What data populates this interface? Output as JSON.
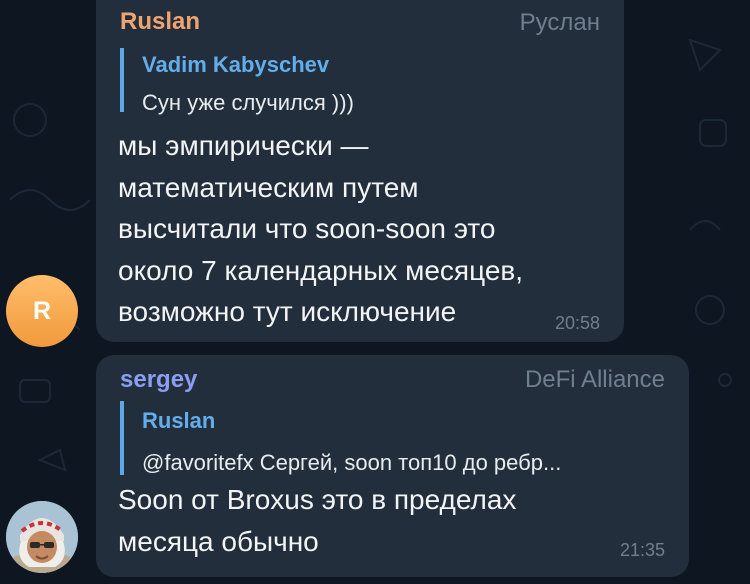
{
  "theme": {
    "background": "#0e1621",
    "bubble": "#222e3b",
    "reply_accent": "#5da6e8",
    "ruslan_name_color": "#f0a470",
    "sergey_name_color": "#8c9ef2"
  },
  "messages": [
    {
      "sender": "Ruslan",
      "title": "Руслан",
      "avatar_letter": "R",
      "reply": {
        "author": "Vadim Kabyschev",
        "text": "Сун уже случился )))"
      },
      "lines": [
        "мы эмпирически  —",
        "математическим путем",
        "высчитали что soon-soon это",
        "около 7 календарных месяцев,",
        "возможно тут исключение"
      ],
      "time": "20:58"
    },
    {
      "sender": "sergey",
      "title": "DeFi Alliance",
      "avatar_icon": "user-photo",
      "reply": {
        "author": "Ruslan",
        "text": "@favoritefx Сергей,  soon топ10 до ребр..."
      },
      "lines": [
        "Soon от Broxus это в пределах",
        "месяца обычно"
      ],
      "time": "21:35"
    }
  ]
}
